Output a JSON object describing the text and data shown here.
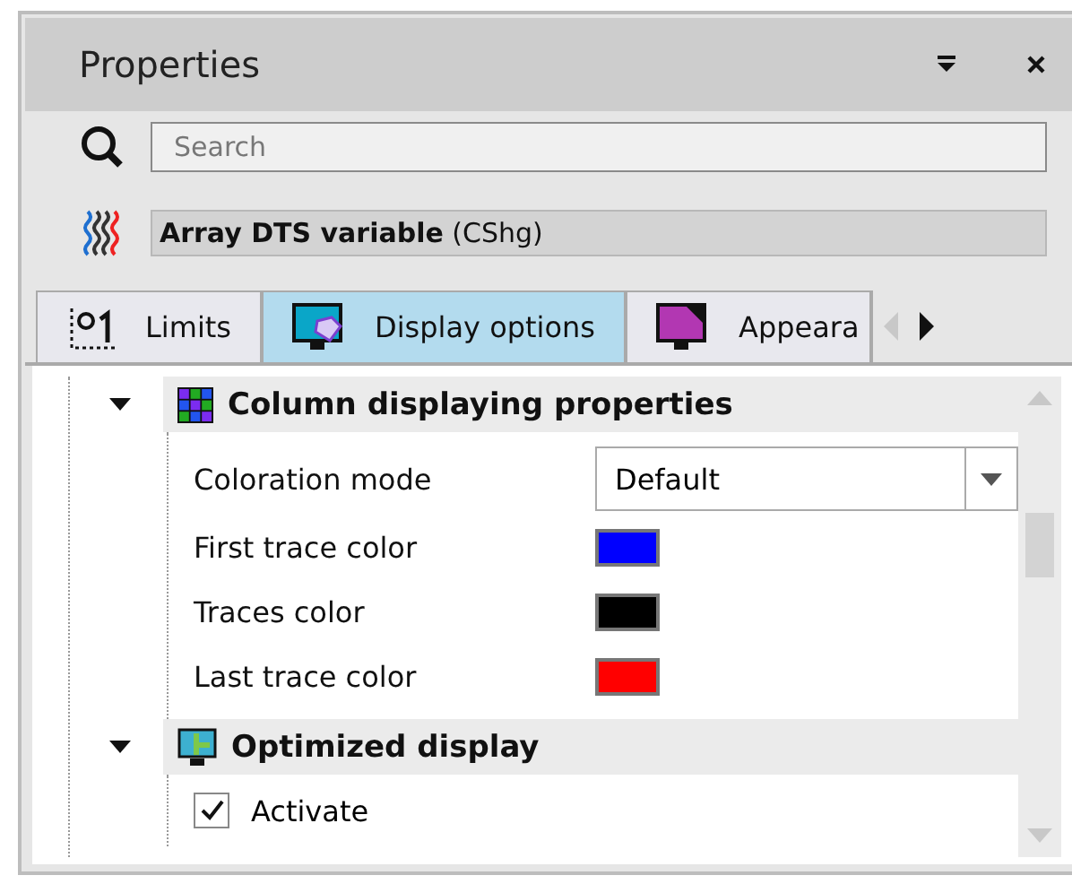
{
  "window": {
    "title": "Properties"
  },
  "search": {
    "placeholder": "Search"
  },
  "variable": {
    "label": "**Array DTS variable** (CShg)"
  },
  "tabs": [
    {
      "label": "Limits",
      "selected": false
    },
    {
      "label": "Display options",
      "selected": true
    },
    {
      "label": "Appeara",
      "selected": false
    }
  ],
  "sections": [
    {
      "title": "Column displaying properties",
      "expanded": true,
      "items": [
        {
          "kind": "dropdown",
          "label": "Coloration mode",
          "value": "Default"
        },
        {
          "kind": "color",
          "label": "First trace color",
          "color": "#0000ff"
        },
        {
          "kind": "color",
          "label": "Traces color",
          "color": "#000000"
        },
        {
          "kind": "color",
          "label": "Last trace color",
          "color": "#ff0000"
        }
      ]
    },
    {
      "title": "Optimized display",
      "expanded": true,
      "items": [
        {
          "kind": "checkbox",
          "label": "Activate",
          "checked": true
        }
      ]
    }
  ]
}
